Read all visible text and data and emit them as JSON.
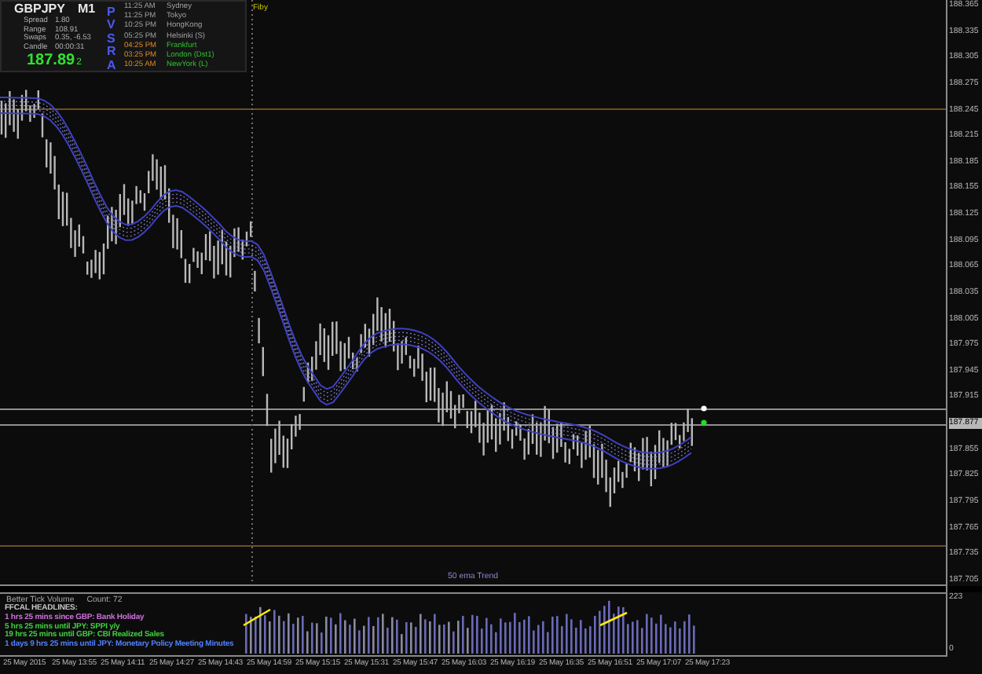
{
  "symbol_panel": {
    "symbol": "GBPJPY",
    "timeframe": "M1",
    "stats": [
      {
        "label": "Spread",
        "value": "1.80"
      },
      {
        "label": "Range",
        "value": "108.91"
      },
      {
        "label": "Swaps",
        "value": "0.35, -6.53"
      },
      {
        "label": "Candle",
        "value": "00:00:31"
      }
    ],
    "price": "187.89",
    "price_last_digit": "2",
    "indicator": "PVSRA",
    "sessions": [
      {
        "time": "11:25 AM",
        "city": "Sydney",
        "open": false
      },
      {
        "time": "11:25 PM",
        "city": "Tokyo",
        "open": false
      },
      {
        "time": "10:25 PM",
        "city": "HongKong",
        "open": false
      },
      {
        "time": "05:25 PM",
        "city": "Helsinki (S)",
        "open": false
      },
      {
        "time": "04:25 PM",
        "city": "Frankfurt",
        "open": true
      },
      {
        "time": "03:25 PM",
        "city": "London (Dst1)",
        "open": true
      },
      {
        "time": "10:25 AM",
        "city": "NewYork (L)",
        "open": true
      }
    ]
  },
  "fibo_label": "Fiby",
  "trend_label": "50 ema Trend",
  "price_axis": [
    {
      "label": "188.365",
      "current": false
    },
    {
      "label": "188.335",
      "current": false
    },
    {
      "label": "188.305",
      "current": false
    },
    {
      "label": "188.275",
      "current": false
    },
    {
      "label": "188.245",
      "current": false
    },
    {
      "label": "188.215",
      "current": false
    },
    {
      "label": "188.185",
      "current": false
    },
    {
      "label": "188.155",
      "current": false
    },
    {
      "label": "188.125",
      "current": false
    },
    {
      "label": "188.095",
      "current": false
    },
    {
      "label": "188.065",
      "current": false
    },
    {
      "label": "188.035",
      "current": false
    },
    {
      "label": "188.005",
      "current": false
    },
    {
      "label": "187.975",
      "current": false
    },
    {
      "label": "187.945",
      "current": false
    },
    {
      "label": "187.915",
      "current": false
    },
    {
      "label": "187.877",
      "current": true
    },
    {
      "label": "187.855",
      "current": false
    },
    {
      "label": "187.825",
      "current": false
    },
    {
      "label": "187.795",
      "current": false
    },
    {
      "label": "187.765",
      "current": false
    },
    {
      "label": "187.735",
      "current": false
    },
    {
      "label": "187.705",
      "current": false
    }
  ],
  "volume_panel": {
    "title": "Better Tick Volume",
    "count": "Count: 72",
    "axis_max": "223",
    "axis_min": "0",
    "headlines_title": "FFCAL HEADLINES:",
    "headlines": [
      {
        "text": "1 hrs 25 mins since GBP: Bank Holiday",
        "color": "#d070e0"
      },
      {
        "text": "5 hrs 25 mins until JPY: SPPI y/y",
        "color": "#40d040"
      },
      {
        "text": "19 hrs 25 mins until GBP: CBI Realized Sales",
        "color": "#40d040"
      },
      {
        "text": "1 days 9 hrs 25 mins until JPY: Monetary Policy Meeting Minutes",
        "color": "#5080ff"
      }
    ]
  },
  "time_axis": [
    "25 May 2015",
    "25 May 13:55",
    "25 May 14:11",
    "25 May 14:27",
    "25 May 14:43",
    "25 May 14:59",
    "25 May 15:15",
    "25 May 15:31",
    "25 May 15:47",
    "25 May 16:03",
    "25 May 16:19",
    "25 May 16:35",
    "25 May 16:51",
    "25 May 17:07",
    "25 May 17:23"
  ]
}
